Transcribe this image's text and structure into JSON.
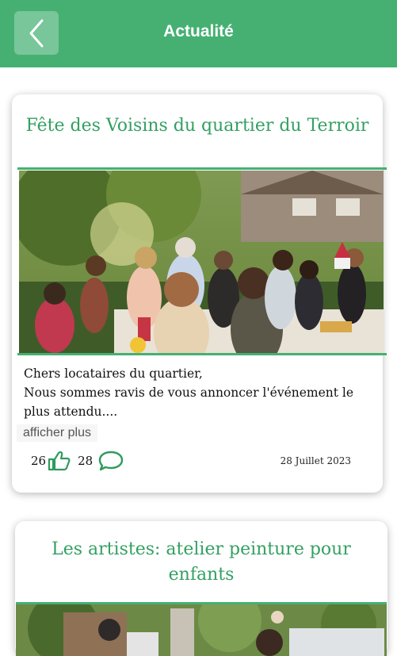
{
  "header": {
    "title": "Actualité"
  },
  "posts": [
    {
      "title": "Fête des Voisins du quartier du Terroir",
      "text_line1": "Chers locataires du quartier,",
      "text_line2": "Nous sommes ravis de vous annoncer l'événement le plus attendu....",
      "more_label": "afficher plus",
      "likes": "26",
      "comments": "28",
      "date": "28 Juillet 2023"
    },
    {
      "title": "Les artistes: atelier peinture pour enfants"
    }
  ],
  "colors": {
    "accent": "#45b072",
    "title_green": "#33a062"
  },
  "icons": [
    "back-icon",
    "thumbs-up-icon",
    "comment-icon"
  ]
}
